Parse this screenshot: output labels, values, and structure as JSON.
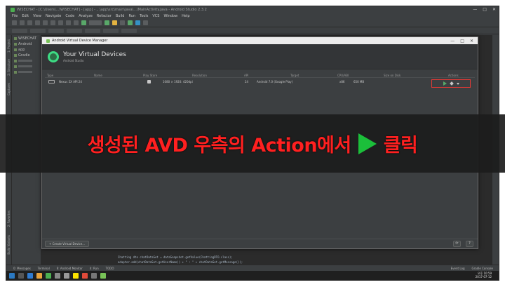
{
  "window": {
    "title": "WISECHAT - [C:\\Users\\...\\WISECHAT] - [app] - ...\\app\\src\\main\\java\\...\\MainActivity.java - Android Studio 2.3.2",
    "controls": [
      "—",
      "□",
      "✕"
    ]
  },
  "menu": [
    "File",
    "Edit",
    "View",
    "Navigate",
    "Code",
    "Analyze",
    "Refactor",
    "Build",
    "Run",
    "Tools",
    "VCS",
    "Window",
    "Help"
  ],
  "breadcrumbs": [
    "WISECHAT",
    "app",
    "src",
    "main",
    "java",
    "wisechat",
    "MainActivity"
  ],
  "left_tools": [
    "1: Project",
    "2: Structure",
    "Captures",
    "2: Favorites",
    "Build Variants"
  ],
  "project_items": [
    "WISECHAT",
    "Android",
    "app",
    "Gradle"
  ],
  "code": [
    "Chatting dto chatDataSet = dataSnapshot.getValue(ChattingDTO.class);",
    "adapter.add(chatDataSet.getUserName() + \" : \" + chatDataSet.getMessage());"
  ],
  "avd_manager": {
    "window_title": "Android Virtual Device Manager",
    "heading": "Your Virtual Devices",
    "subheading": "Android Studio",
    "columns": [
      "Type",
      "Name",
      "Play Store",
      "Resolution",
      "API",
      "Target",
      "CPU/ABI",
      "Size on Disk",
      "Actions"
    ],
    "devices": [
      {
        "name": "Nexus 5X API 24",
        "resolution": "1080 × 1920: 420dpi",
        "api": "24",
        "target": "Android 7.0 (Google Play)",
        "cpu": "x86",
        "size": "650 MB"
      }
    ],
    "create_button": "+ Create Virtual Device...",
    "refresh_button": "⟳",
    "help_button": "?"
  },
  "bottom_tools": [
    "0: Messages",
    "Terminal",
    "6: Android Monitor",
    "4: Run",
    "TODO"
  ],
  "bottom_tools_right": [
    "Event Log",
    "Gradle Console"
  ],
  "status": {
    "message": "Gradle build finished in 1s 980ms (16 minutes ago)",
    "position": "32:50",
    "line_sep": "CRLF‡",
    "encoding": "UTF-8‡",
    "context": "Context: <no context>"
  },
  "taskbar": {
    "time": "오후 10:59",
    "date": "2017-07-12"
  },
  "banner": {
    "text_before": "생성된 AVD 우측의 Action에서",
    "text_after": "클릭"
  },
  "colors": {
    "ide_bg": "#3c3f41",
    "editor_bg": "#2b2b2b",
    "highlight_box": "#e53935",
    "banner_text": "#ff2020",
    "banner_play": "#1bbf3a"
  }
}
